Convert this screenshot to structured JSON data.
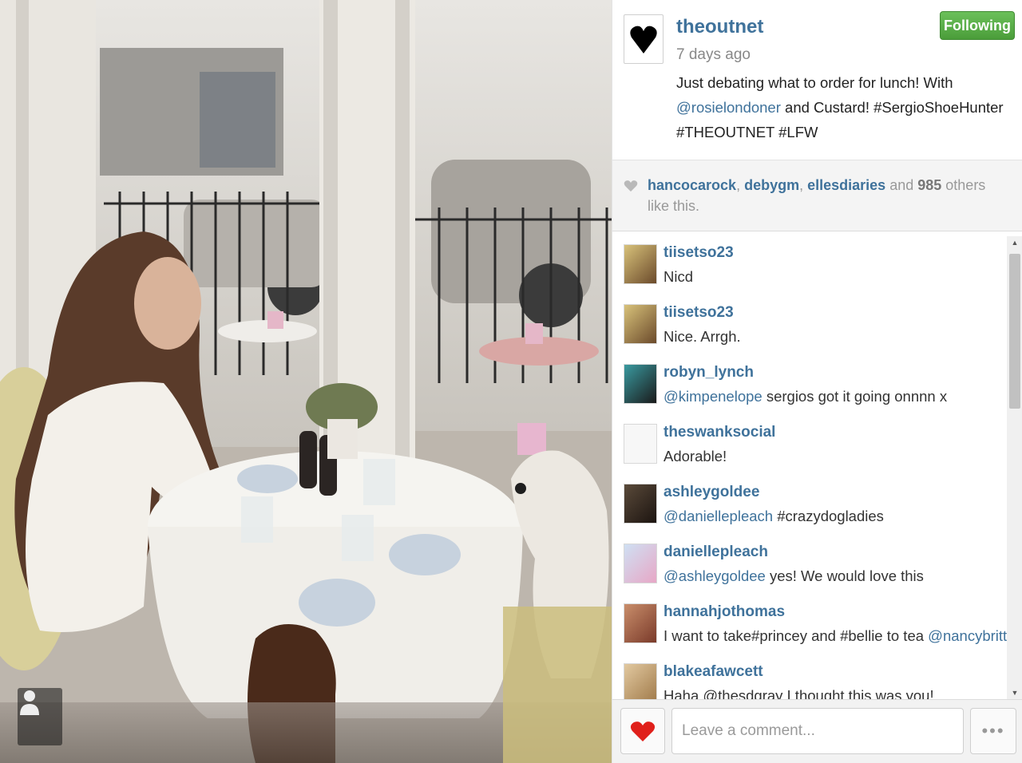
{
  "post": {
    "username": "theoutnet",
    "follow_label": "Following",
    "timestamp": "7 days ago",
    "caption": {
      "line1": "Just debating what to order for lunch! With",
      "mention": "@rosielondoner",
      "line2_rest": " and Custard! #SergioShoeHunter",
      "line3": "#THEOUTNET #LFW"
    }
  },
  "likes": {
    "users": [
      "hancocarock",
      "debygm",
      "ellesdiaries"
    ],
    "sep": ", ",
    "and": " and ",
    "count": "985",
    "suffix": " others like this."
  },
  "comments": [
    {
      "user": "tiisetso23",
      "mention": "",
      "text": "Nicd"
    },
    {
      "user": "tiisetso23",
      "mention": "",
      "text": "Nice. Arrgh."
    },
    {
      "user": "robyn_lynch",
      "mention": "@kimpenelope",
      "text": " sergios got it going onnnn x"
    },
    {
      "user": "theswanksocial",
      "mention": "",
      "text": "Adorable!"
    },
    {
      "user": "ashleygoldee",
      "mention": "@daniellepleach",
      "text": " #crazydogladies"
    },
    {
      "user": "daniellepleach",
      "mention": "@ashleygoldee",
      "text": " yes! We would love this"
    },
    {
      "user": "hannahjothomas",
      "mention": "",
      "text": "I want to take#princey and #bellie to tea ",
      "mention_end": "@nancybritt",
      "text_end": " !"
    },
    {
      "user": "blakeafawcett",
      "mention": "",
      "text": "Haha @thesdgray I thought this was you!"
    }
  ],
  "footer": {
    "comment_placeholder": "Leave a comment...",
    "more_label": "•••"
  },
  "colors": {
    "link": "#3f729b",
    "following": "#5aaf48",
    "heart": "#e0201b"
  }
}
